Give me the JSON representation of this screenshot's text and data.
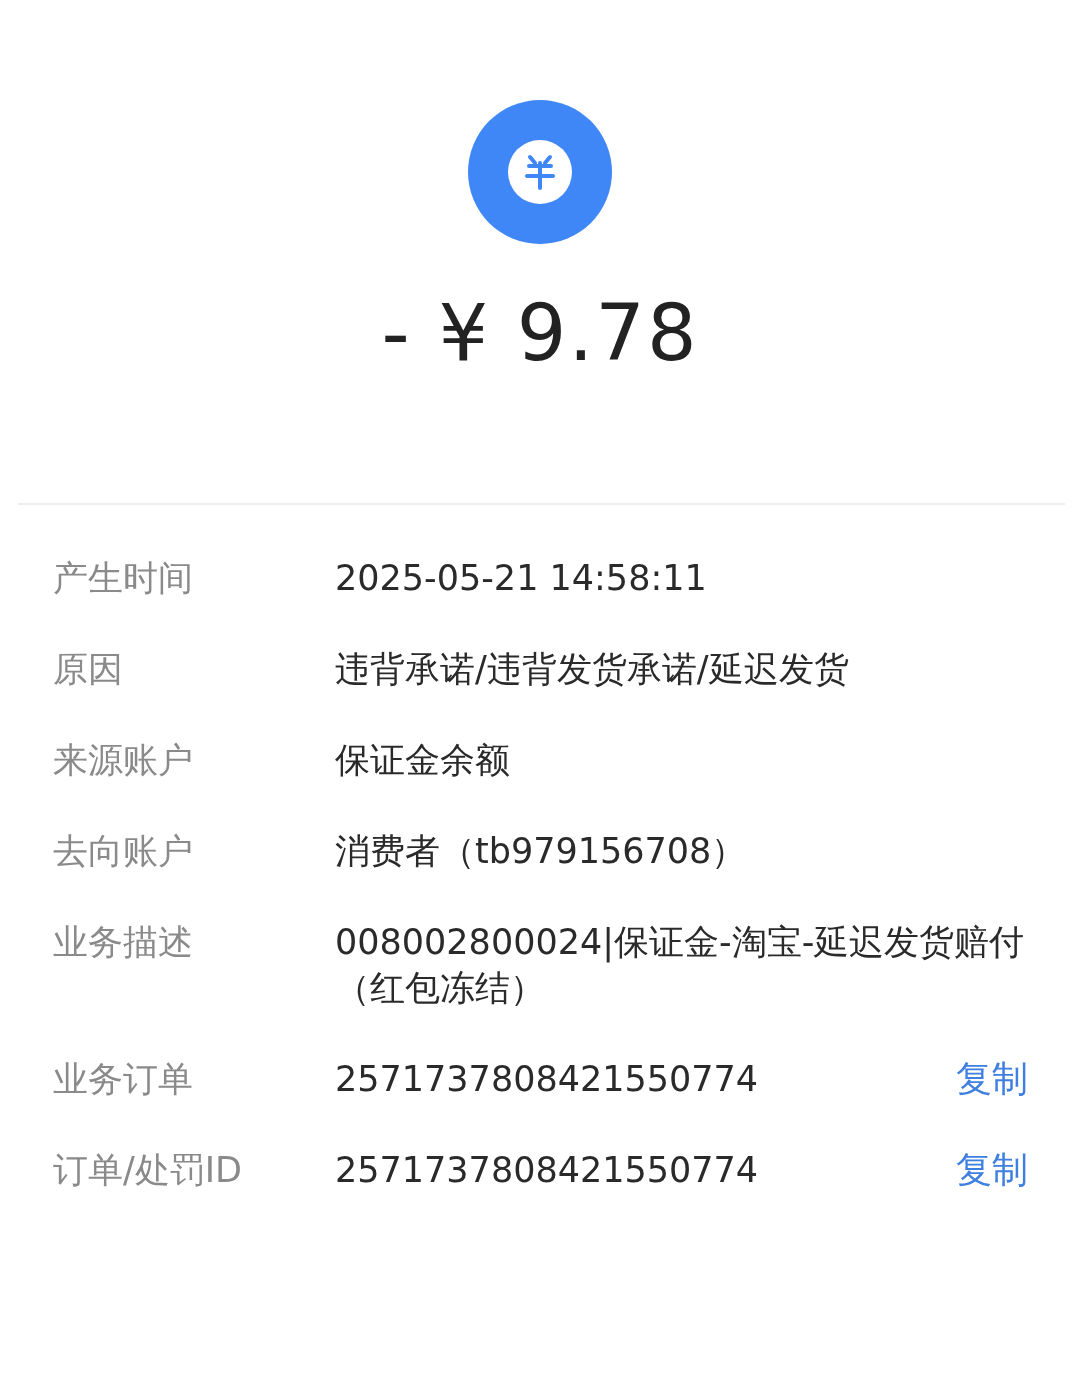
{
  "amount": "- ¥ 9.78",
  "details": [
    {
      "label": "产生时间",
      "value": "2025-05-21 14:58:11"
    },
    {
      "label": "原因",
      "value": "违背承诺/违背发货承诺/延迟发货"
    },
    {
      "label": "来源账户",
      "value": "保证金余额"
    },
    {
      "label": "去向账户",
      "value": "消费者（tb979156708）"
    },
    {
      "label": "业务描述",
      "value": "008002800024|保证金-淘宝-延迟发货赔付（红包冻结）"
    },
    {
      "label": "业务订单",
      "value": "2571737808421550774",
      "action": "复制"
    },
    {
      "label": "订单/处罚ID",
      "value": "2571737808421550774",
      "action": "复制"
    }
  ]
}
